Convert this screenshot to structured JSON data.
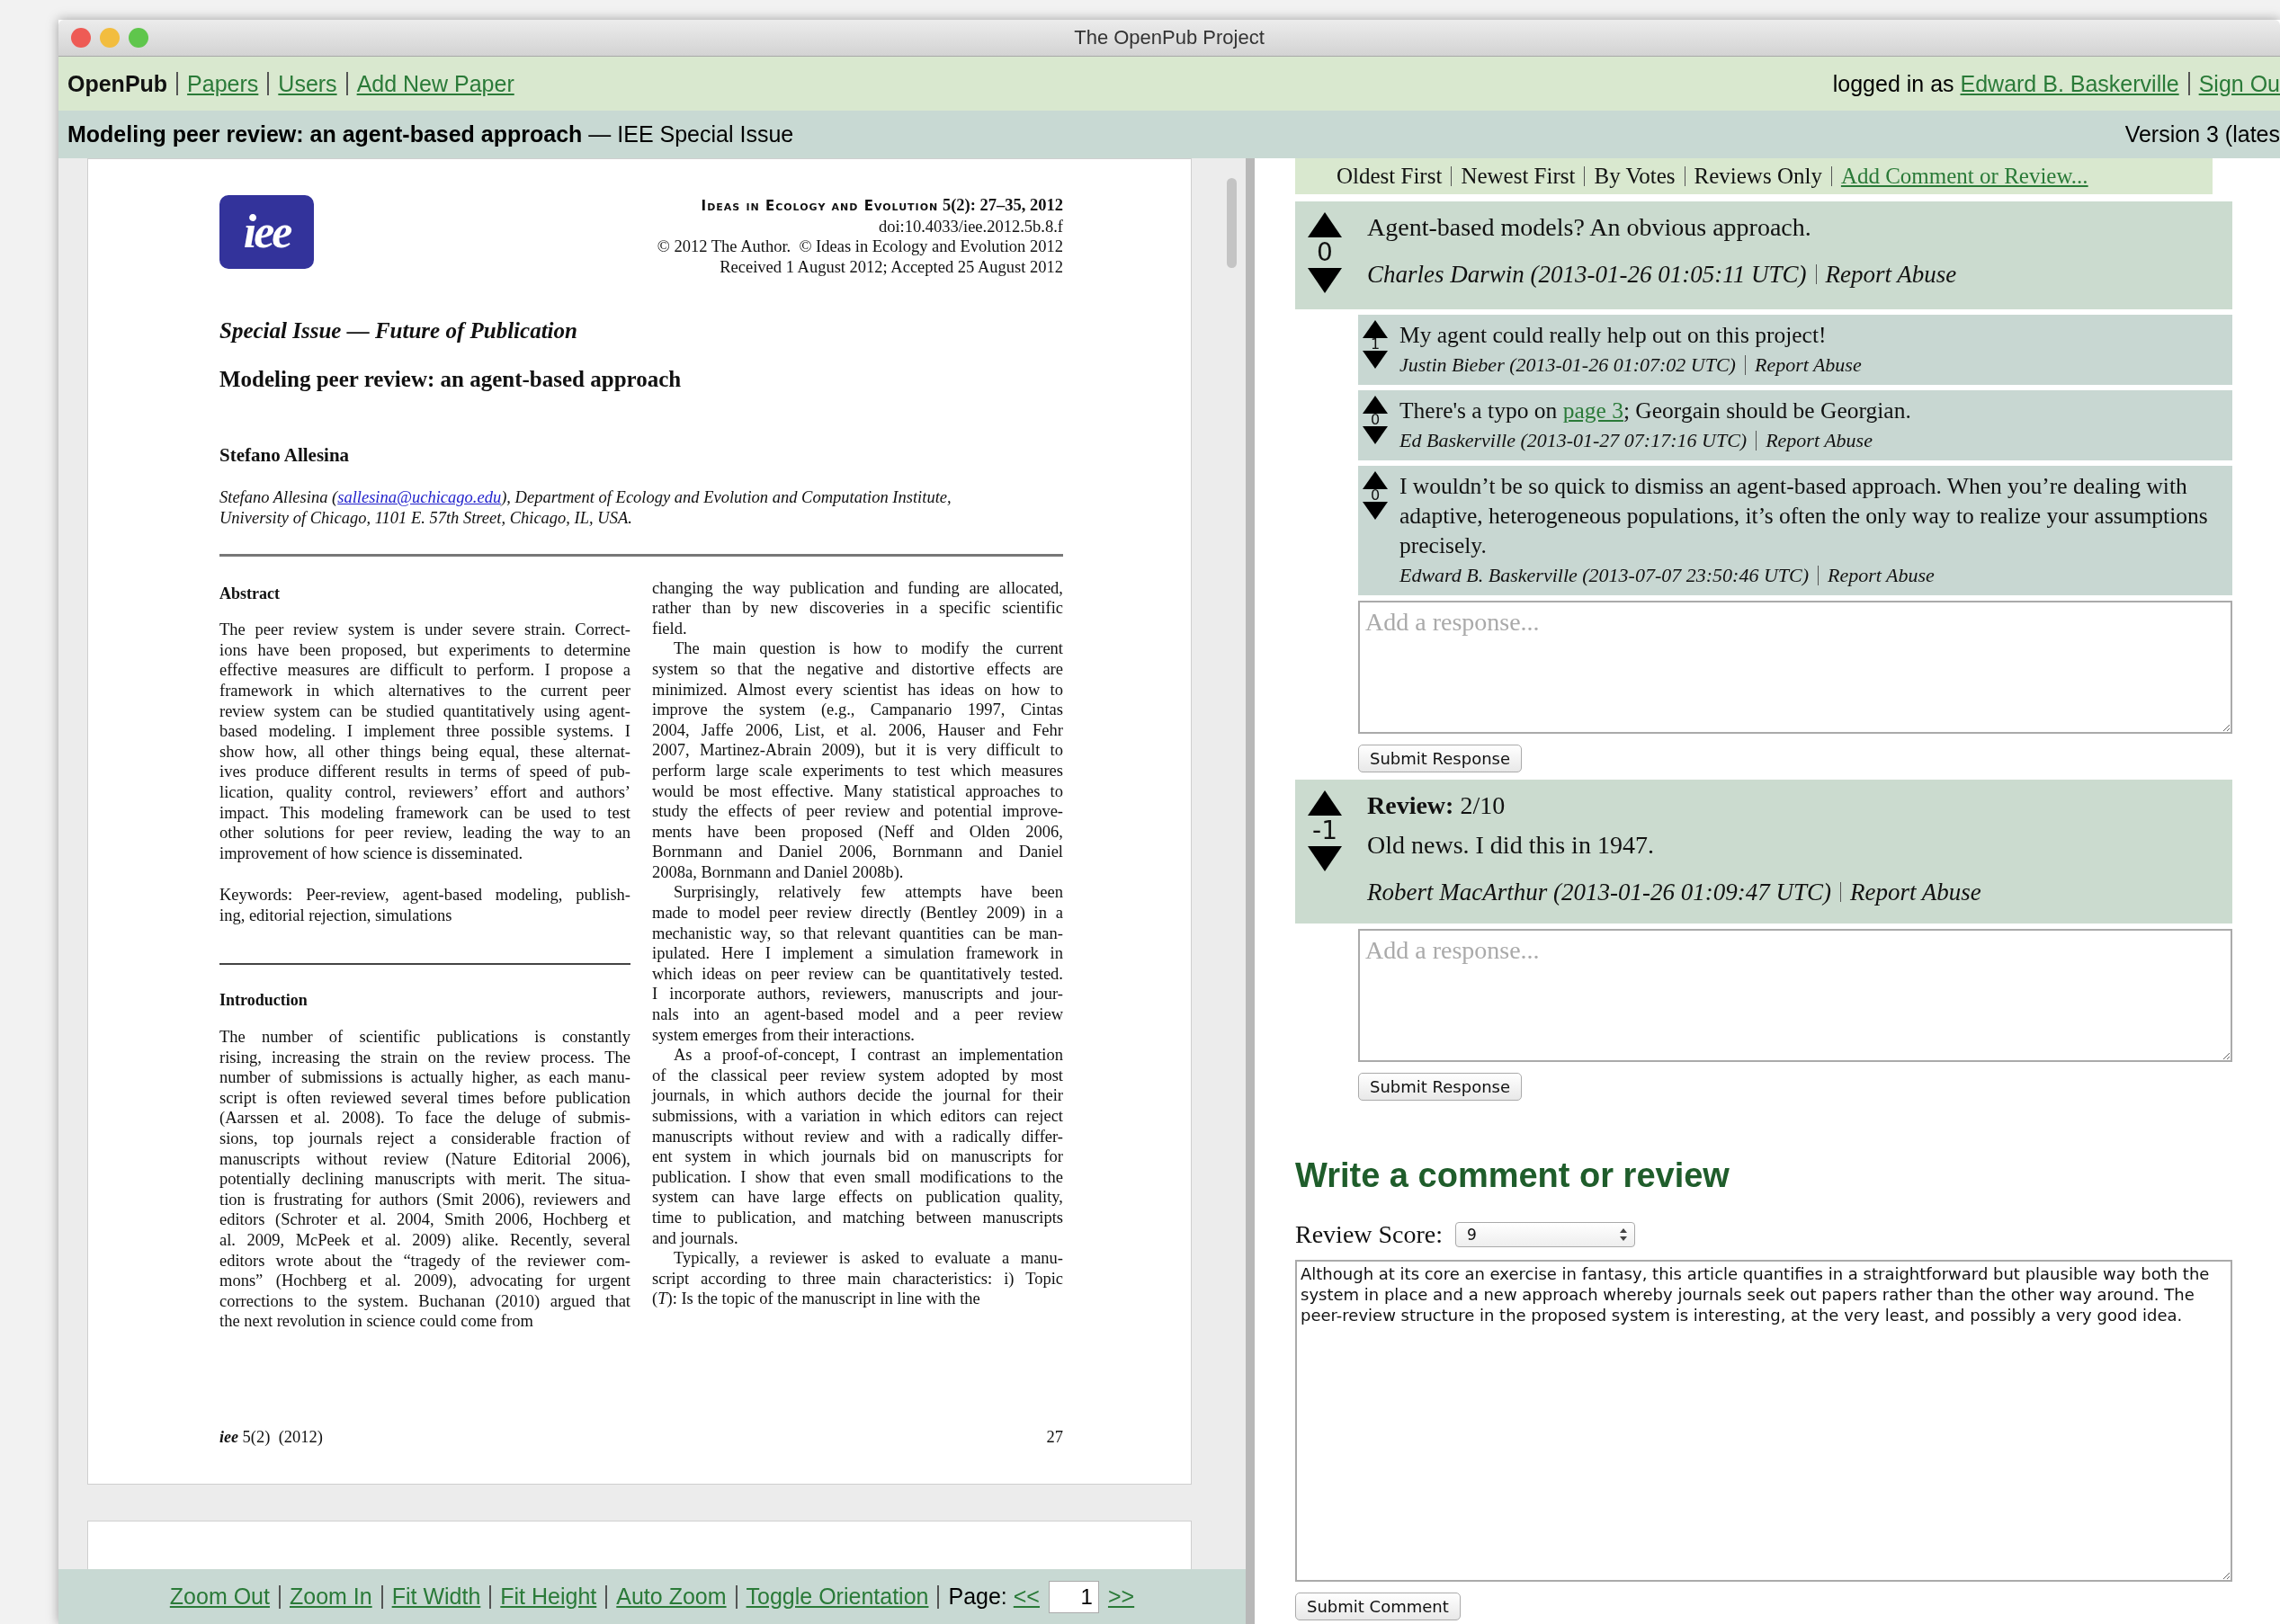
{
  "window": {
    "title": "The OpenPub Project"
  },
  "nav": {
    "brand": "OpenPub",
    "links": [
      "Papers",
      "Users",
      "Add New Paper"
    ],
    "user_prefix": "logged in as",
    "user": "Edward B. Baskerville",
    "sign_out": "Sign Ou"
  },
  "paper_bar": {
    "title": "Modeling peer review: an agent-based approach",
    "issue": "— IEE Special Issue",
    "version": "Version 3 (lates"
  },
  "document": {
    "page": {
      "logo": "iee",
      "journal": "Ideas in Ecology and Evolution",
      "citation": "5(2): 27–35, 2012",
      "doi": "doi:10.4033/iee.2012.5b.8.f",
      "copyright": "© 2012 The Author.  © Ideas in Ecology and Evolution 2012",
      "received": "Received 1 August 2012; Accepted 25 August 2012",
      "special_issue": "Special Issue — Future of Publication",
      "title": "Modeling peer review: an agent-based approach",
      "author": "Stefano Allesina",
      "affiliation_before": "Stefano Allesina (",
      "email": "sallesina@uchicago.edu",
      "affiliation_after": [
        "), Department of Ecology and Evolution and Computation Institute,",
        "University of Chicago, 1101 E. 57th Street, Chicago, IL, USA."
      ],
      "left_column": [
        {
          "kind": "heading",
          "text": "Abstract"
        },
        {
          "kind": "paragraph",
          "indent": false,
          "lines": [
            "The peer review system is under severe strain. Correct-",
            "ions have been proposed, but experiments to determine",
            "effective measures are difficult to perform. I propose a",
            "framework in which alternatives to the current peer",
            "review system can be studied quantitatively using agent-",
            "based modeling. I implement three possible systems. I",
            "show how, all other things being equal, these alternat-",
            "ives produce different results in terms of speed of pub-",
            "lication, quality control, reviewers’ effort and authors’",
            "impact. This modeling framework can be used to test",
            "other solutions for peer review, leading the way to an",
            "improvement of how science is disseminated."
          ]
        },
        {
          "kind": "paragraph",
          "indent": false,
          "lines": [
            "Keywords: Peer-review, agent-based modeling, publish-",
            "ing, editorial rejection, simulations"
          ]
        },
        {
          "kind": "rule"
        },
        {
          "kind": "heading",
          "text": "Introduction"
        },
        {
          "kind": "paragraph",
          "indent": false,
          "lines": [
            "The number of scientific publications is constantly",
            "rising, increasing the strain on the review process. The",
            "number of submissions is actually higher, as each manu-",
            "script is often reviewed several times before publication",
            "(Aarssen et al. 2008). To face the deluge of submis-",
            "sions, top journals reject a considerable fraction of",
            "manuscripts without review (Nature Editorial 2006),",
            "potentially declining manuscripts with merit. The situa-",
            "tion is frustrating for authors (Smit 2006), reviewers and",
            "editors (Schroter et al. 2004, Smith 2006, Hochberg et",
            "al. 2009, McPeek et al. 2009) alike. Recently, several",
            "editors wrote about the “tragedy of the reviewer com-",
            "mons” (Hochberg et al. 2009), advocating for urgent",
            "corrections to the system. Buchanan (2010) argued that",
            "the next revolution in science could come from"
          ]
        }
      ],
      "right_column": [
        {
          "kind": "paragraph",
          "indent": false,
          "lines": [
            "changing the way publication and funding are allocated,",
            "rather than by new discoveries in a specific scientific",
            "field."
          ]
        },
        {
          "kind": "paragraph",
          "indent": true,
          "lines": [
            "The main question is how to modify the current",
            "system so that the negative and distortive effects are",
            "minimized. Almost every scientist has ideas on how to",
            "improve the system (e.g., Campanario 1997, Cintas",
            "2004, Jaffe 2006, List, et al.  2006, Hauser and Fehr",
            "2007, Martinez-Abrain 2009), but it is very difficult to",
            "perform large scale experiments to test which measures",
            "would be most effective. Many statistical approaches to",
            "study the effects of peer review and potential improve-",
            "ments have been proposed (Neff and Olden 2006,",
            "Bornmann and Daniel 2006, Bornmann and Daniel",
            "2008a, Bornmann and Daniel 2008b)."
          ]
        },
        {
          "kind": "paragraph",
          "indent": true,
          "lines": [
            "Surprisingly, relatively few attempts have been",
            "made to model peer review directly (Bentley 2009) in a",
            "mechanistic way, so that relevant quantities can be man-",
            "ipulated. Here I implement a simulation framework in",
            "which ideas on peer review can be quantitatively tested.",
            "I incorporate authors, reviewers, manuscripts and jour-",
            "nals into an agent-based model and a peer review",
            "system emerges from their interactions."
          ]
        },
        {
          "kind": "paragraph",
          "indent": true,
          "lines": [
            "As a proof-of-concept, I contrast an implementation",
            "of the classical peer review system adopted by most",
            "journals, in which authors decide the journal for their",
            "submissions, with a variation in which editors can reject",
            "manuscripts without review and with a radically differ-",
            "ent system in which journals bid on manuscripts for",
            "publication. I show that even small modifications to the",
            "system can have large effects on publication quality,",
            "time to publication, and matching between manuscripts",
            "and journals."
          ]
        },
        {
          "kind": "paragraph",
          "indent": true,
          "lines": [
            "Typically, a reviewer is asked to evaluate a manu-",
            "script according to three main characteristics: i) Topic",
            "(*T*): Is the topic of the manuscript in line with the"
          ]
        }
      ],
      "footer_logo": "iee",
      "footer_issue": "5(2)  (2012)",
      "page_number": "27"
    },
    "toolbar": {
      "links": [
        "Zoom Out",
        "Zoom In",
        "Fit Width",
        "Fit Height",
        "Auto Zoom",
        "Toggle Orientation"
      ],
      "page_label": "Page:",
      "prev": "<<",
      "page": "1",
      "next": ">>"
    }
  },
  "comments": {
    "sort_options": [
      "Oldest First",
      "Newest First",
      "By Votes",
      "Reviews Only"
    ],
    "add_link": "Add Comment or Review...",
    "threads": [
      {
        "kind": "comment",
        "score": "0",
        "text": "Agent-based models? An obvious approach.",
        "author": "Charles Darwin (2013-01-26 01:05:11 UTC)",
        "report": "Report Abuse",
        "replies": [
          {
            "score": "1",
            "text": "My agent could really help out on this project!",
            "author": "Justin Bieber (2013-01-26 01:07:02 UTC)",
            "report": "Report Abuse"
          },
          {
            "score": "0",
            "text_before": "There's a typo on ",
            "link": "page 3",
            "text_after": "; Georgain should be Georgian.",
            "author": "Ed Baskerville (2013-01-27 07:17:16 UTC)",
            "report": "Report Abuse"
          },
          {
            "score": "0",
            "text": "I wouldn’t be so quick to dismiss an agent-based approach. When you’re dealing with adaptive, heterogeneous populations, it’s often the only way to realize your assumptions precisely.",
            "author": "Edward B. Baskerville (2013-07-07 23:50:46 UTC)",
            "report": "Report Abuse"
          }
        ],
        "response_placeholder": "Add a response...",
        "submit": "Submit Response"
      },
      {
        "kind": "review",
        "rating": "**Review:** 2/10",
        "score": "-1",
        "text": "Old news. I did this in 1947.",
        "author": "Robert MacArthur (2013-01-26 01:09:47 UTC)",
        "report": "Report Abuse",
        "response_placeholder": "Add a response...",
        "submit": "Submit Response"
      }
    ]
  },
  "compose": {
    "heading": "Write a comment or review",
    "score_label": "Review Score:",
    "score": "9",
    "text": "Although at its core an exercise in fantasy, this article quantifies in a straightforward but plausible way both the system in place and a new approach whereby journals seek out papers rather than the other way around. The peer-review structure in the proposed system is interesting, at the very least, and possibly a very good idea.",
    "submit": "Submit Comment"
  }
}
